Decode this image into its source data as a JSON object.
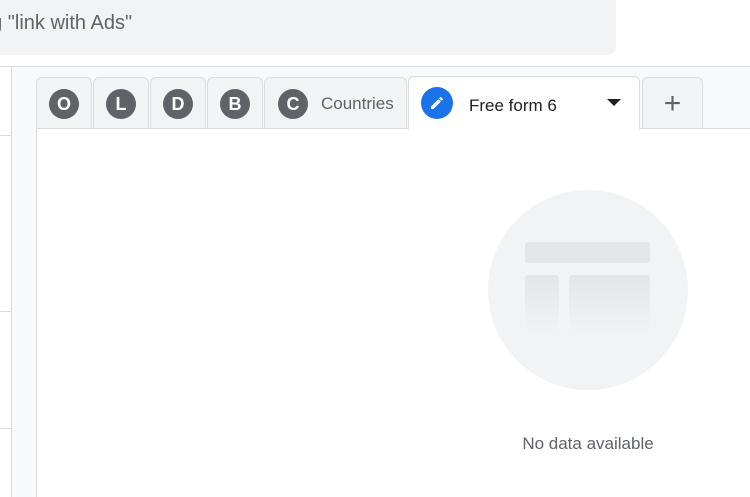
{
  "search": {
    "text": "ng \"link with Ads\""
  },
  "tabs": [
    {
      "letter": "O"
    },
    {
      "letter": "L"
    },
    {
      "letter": "D"
    },
    {
      "letter": "B"
    }
  ],
  "countries_tab": {
    "letter": "C",
    "label": "Countries"
  },
  "active_tab": {
    "label": "Free form 6",
    "icon": "pencil-icon"
  },
  "add_tab": {
    "icon": "plus-icon",
    "symbol": "+"
  },
  "content": {
    "empty_message": "No data available",
    "illustration": "empty-table-illustration"
  },
  "colors": {
    "accent": "#1a73e8",
    "tab_circle": "#5f6368",
    "canvas": "#f8f9fa"
  }
}
